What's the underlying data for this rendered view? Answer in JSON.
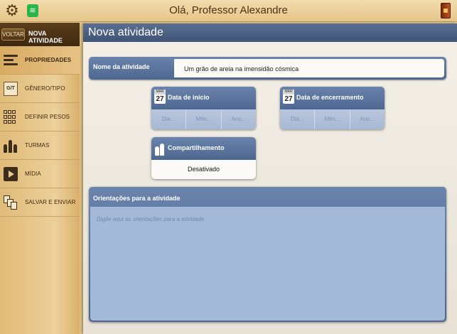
{
  "topbar": {
    "greeting": "Olá, Professor Alexandre"
  },
  "sidebar": {
    "back_label": "VOLTAR",
    "title": "NOVA ATIVIDADE",
    "items": [
      {
        "label": "PROPRIEDADES",
        "icon": "properties-icon",
        "active": true
      },
      {
        "label": "GÊNERO/TIPO",
        "icon": "genre-icon",
        "active": false
      },
      {
        "label": "DEFINIR PESOS",
        "icon": "weights-grid-icon",
        "active": false
      },
      {
        "label": "TURMAS",
        "icon": "classes-icon",
        "active": false
      },
      {
        "label": "MÍDIA",
        "icon": "media-play-icon",
        "active": false
      },
      {
        "label": "SALVAR E ENVIAR",
        "icon": "save-send-icon",
        "active": false
      }
    ]
  },
  "main": {
    "title": "Nova atividade",
    "name": {
      "label": "Nome da atividade",
      "value": "Um grão de areia na imensidão cósmica"
    },
    "start_date": {
      "title": "Data de início",
      "cal_month": "MAR",
      "cal_day": "27",
      "day_ph": "Dia...",
      "month_ph": "Mês...",
      "year_ph": "Ano..."
    },
    "end_date": {
      "title": "Data de encerramento",
      "cal_month": "MAR",
      "cal_day": "27",
      "day_ph": "Dia...",
      "month_ph": "Mês...",
      "year_ph": "Ano..."
    },
    "sharing": {
      "title": "Compartilhamento",
      "value": "Desativado"
    },
    "orientations": {
      "label": "Orientações para a atividade",
      "placeholder": "Digite aqui as orientações para a atividade."
    }
  },
  "colors": {
    "header_blue": "#4d6791",
    "field_blue": "#a5b9d8",
    "wood": "#e9c98c"
  }
}
